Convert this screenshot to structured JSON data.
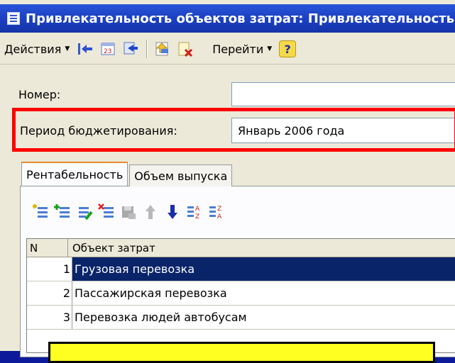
{
  "window": {
    "title": "Привлекательность объектов затрат: Привлекательность объектов затрат"
  },
  "toolbar": {
    "actions_label": "Действия",
    "goto_label": "Перейти",
    "help_label": "?"
  },
  "form": {
    "number_label": "Номер:",
    "number_value": "",
    "period_label": "Период бюджетирования:",
    "period_value": "Январь 2006 года"
  },
  "tabs": [
    {
      "label": "Рентабельность",
      "active": true
    },
    {
      "label": "Объем выпуска",
      "active": false
    }
  ],
  "table": {
    "columns": [
      "N",
      "Объект затрат"
    ],
    "rows": [
      {
        "n": "1",
        "object": "Грузовая перевозка",
        "selected": true
      },
      {
        "n": "2",
        "object": "Пассажирская перевозка",
        "selected": false
      },
      {
        "n": "3",
        "object": "Перевозка людей автобусам",
        "selected": false
      }
    ]
  },
  "icons": {
    "toolbar": [
      "arrow-left-icon",
      "calendar-icon",
      "swap-icon",
      "document-up-icon",
      "document-delete-icon",
      "help-icon"
    ],
    "table_tools": [
      "add-row-icon",
      "copy-row-icon",
      "edit-row-icon",
      "delete-row-icon",
      "save-icon",
      "move-up-icon",
      "move-down-icon",
      "sort-az-icon",
      "sort-za-icon"
    ]
  },
  "colors": {
    "title_bar": "#2a55d8",
    "highlight_border": "#ff0000",
    "selected_row": "#0a246a",
    "hint_box": "#ffff22"
  }
}
